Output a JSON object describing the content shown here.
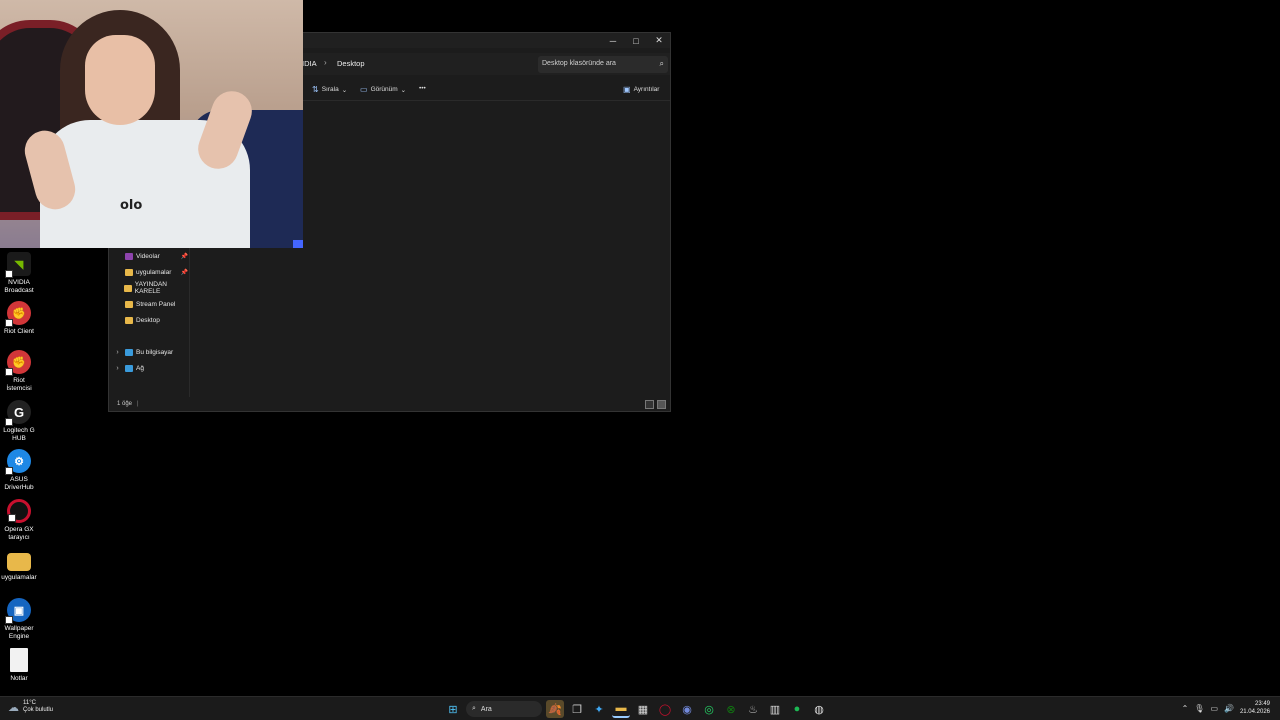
{
  "desktop": {
    "icons": [
      {
        "label": "NVIDIA Broadcast",
        "icon": "nvidia-broadcast-icon",
        "color": "#76b900"
      },
      {
        "label": "Riot Client",
        "icon": "riot-client-icon",
        "color": "#d13639"
      },
      {
        "label": "Riot İstemcisi",
        "icon": "riot-client-icon",
        "color": "#d13639"
      },
      {
        "label": "Logitech G HUB",
        "icon": "logitech-g-hub-icon",
        "color": "#222222"
      },
      {
        "label": "ASUS DriverHub",
        "icon": "asus-driverhub-icon",
        "color": "#1e88e5"
      },
      {
        "label": "Opera GX tarayıcı",
        "icon": "opera-gx-icon",
        "color": "#c8102e"
      },
      {
        "label": "uygulamalar",
        "icon": "folder-icon",
        "color": "#e8b84a"
      },
      {
        "label": "Wallpaper Engine",
        "icon": "wallpaper-engine-icon",
        "color": "#1565c0"
      },
      {
        "label": "Notlar",
        "icon": "text-file-icon",
        "color": "#f2f2f2"
      }
    ]
  },
  "explorer": {
    "breadcrumb": [
      "IDIA",
      "Desktop"
    ],
    "search_placeholder": "Desktop klasöründe ara",
    "commands": {
      "sort": "Sırala",
      "view": "Görünüm",
      "more": "•••",
      "details": "Ayrıntılar"
    },
    "nav": [
      {
        "label": "Videolar",
        "pinned": true,
        "icon": "videos-folder-icon",
        "color": "#8e44ad"
      },
      {
        "label": "uygulamalar",
        "pinned": true,
        "icon": "folder-icon",
        "color": "#e8b84a"
      },
      {
        "label": "YAYINDAN KARELE",
        "pinned": false,
        "icon": "folder-icon",
        "color": "#e8b84a"
      },
      {
        "label": "Stream Panel",
        "pinned": false,
        "icon": "folder-icon",
        "color": "#e8b84a"
      },
      {
        "label": "Desktop",
        "pinned": false,
        "icon": "folder-icon",
        "color": "#e8b84a"
      },
      {
        "label": "Bu bilgisayar",
        "pinned": false,
        "icon": "this-pc-icon",
        "color": "#3a9bdc"
      },
      {
        "label": "Ağ",
        "pinned": false,
        "icon": "network-icon",
        "color": "#3a9bdc"
      }
    ],
    "status": "1 öğe"
  },
  "webcam": {
    "logo_text": "olo"
  },
  "taskbar": {
    "weather": {
      "temp": "11°C",
      "desc": "Çok bulutlu"
    },
    "search_label": "Ara",
    "time": "23:49",
    "date": "21.04.2026"
  }
}
